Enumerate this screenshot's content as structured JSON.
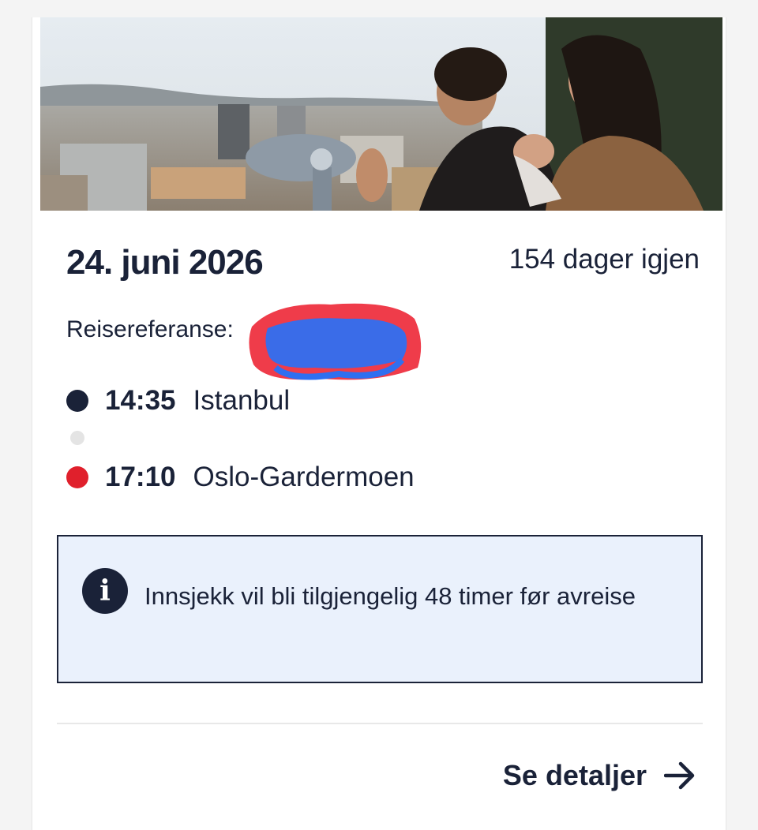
{
  "trip": {
    "date": "24. juni 2026",
    "days_left": "154 dager igjen",
    "reference_label": "Reisereferanse:",
    "reference_value_redacted": true
  },
  "itinerary": {
    "departure": {
      "time": "14:35",
      "place": "Istanbul",
      "dot_color": "#1a2238"
    },
    "arrival": {
      "time": "17:10",
      "place": "Oslo-Gardermoen",
      "dot_color": "#e0202c"
    }
  },
  "notice": {
    "icon": "info-icon",
    "glyph": "i",
    "text": "Innsjekk vil bli tilgjengelig 48 timer før avreise"
  },
  "actions": {
    "details_label": "Se detaljer",
    "details_icon": "arrow-right-icon"
  },
  "colors": {
    "text": "#1a2238",
    "accent_red": "#e0202c",
    "notice_bg": "#eaf1fc"
  }
}
